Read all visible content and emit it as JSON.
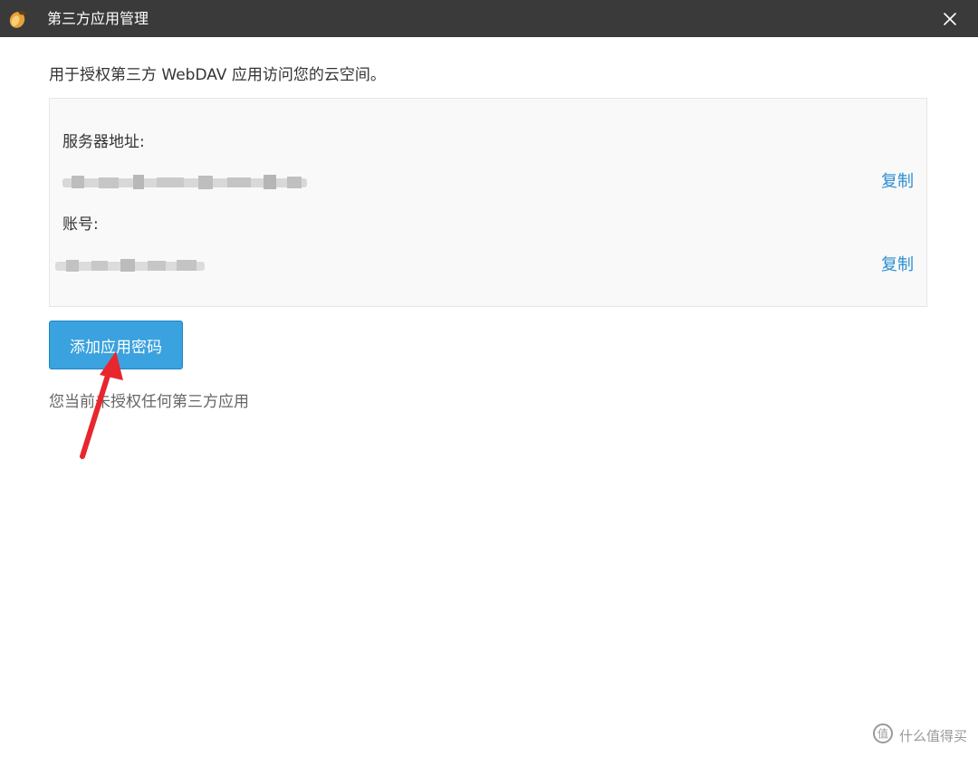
{
  "window": {
    "title": "第三方应用管理",
    "icon": "acorn-app-icon",
    "close_icon": "close-icon"
  },
  "intro_text": "用于授权第三方 WebDAV 应用访问您的云空间。",
  "info_panel": {
    "server_label": "服务器地址:",
    "server_copy": "复制",
    "account_label": "账号:",
    "account_copy": "复制"
  },
  "add_button_label": "添加应用密码",
  "empty_text": "您当前未授权任何第三方应用",
  "annotation": {
    "arrow_color": "#e8262e"
  },
  "watermark": {
    "text": "什么值得买",
    "icon": "smzdm-logo-icon"
  },
  "colors": {
    "accent": "#3aa2de",
    "link": "#2b8ed2",
    "titlebar": "#3a3a3a"
  }
}
